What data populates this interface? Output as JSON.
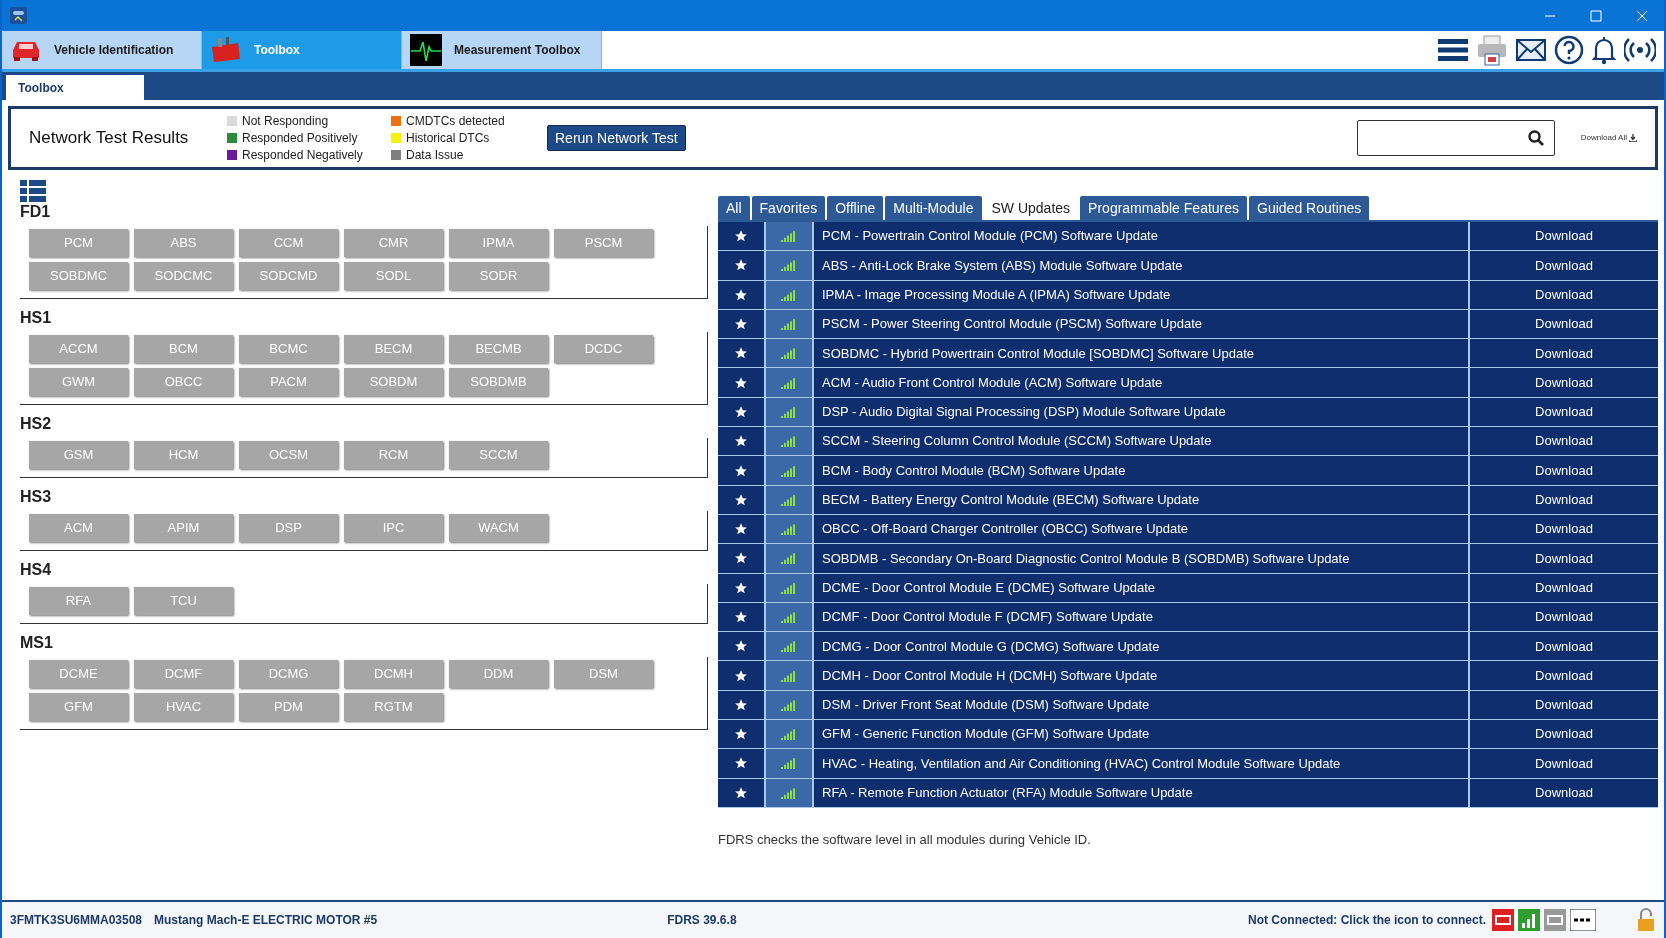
{
  "top_tabs": [
    {
      "label": "Vehicle Identification",
      "kind": "car",
      "selected": false
    },
    {
      "label": "Toolbox",
      "kind": "toolbox",
      "selected": true
    },
    {
      "label": "Measurement Toolbox",
      "kind": "scope",
      "selected": false
    }
  ],
  "sub_tabs": [
    {
      "label": "Toolbox",
      "selected": true
    }
  ],
  "network": {
    "title": "Network Test Results",
    "legend": [
      {
        "label": "Not Responding",
        "color": "#d9d9d9"
      },
      {
        "label": "Responded Positively",
        "color": "#2e8b3e"
      },
      {
        "label": "Responded Negatively",
        "color": "#6a1b9a"
      },
      {
        "label": "CMDTCs detected",
        "color": "#f07010"
      },
      {
        "label": "Historical DTCs",
        "color": "#f5f20a"
      },
      {
        "label": "Data Issue",
        "color": "#7f7f7f"
      }
    ],
    "rerun_button": "Rerun Network Test",
    "download_all": "Download All"
  },
  "groups": [
    {
      "name": "FD1",
      "modules": [
        "PCM",
        "ABS",
        "CCM",
        "CMR",
        "IPMA",
        "PSCM",
        "SOBDMC",
        "SODCMC",
        "SODCMD",
        "SODL",
        "SODR"
      ]
    },
    {
      "name": "HS1",
      "modules": [
        "ACCM",
        "BCM",
        "BCMC",
        "BECM",
        "BECMB",
        "DCDC",
        "GWM",
        "OBCC",
        "PACM",
        "SOBDM",
        "SOBDMB"
      ]
    },
    {
      "name": "HS2",
      "modules": [
        "GSM",
        "HCM",
        "OCSM",
        "RCM",
        "SCCM"
      ]
    },
    {
      "name": "HS3",
      "modules": [
        "ACM",
        "APIM",
        "DSP",
        "IPC",
        "WACM"
      ]
    },
    {
      "name": "HS4",
      "modules": [
        "RFA",
        "TCU"
      ]
    },
    {
      "name": "MS1",
      "modules": [
        "DCME",
        "DCMF",
        "DCMG",
        "DCMH",
        "DDM",
        "DSM",
        "GFM",
        "HVAC",
        "PDM",
        "RGTM"
      ]
    }
  ],
  "tool_tabs": [
    {
      "label": "All",
      "selected": false
    },
    {
      "label": "Favorites",
      "selected": false
    },
    {
      "label": "Offline",
      "selected": false
    },
    {
      "label": "Multi-Module",
      "selected": false
    },
    {
      "label": "SW Updates",
      "selected": true
    },
    {
      "label": "Programmable Features",
      "selected": false
    },
    {
      "label": "Guided Routines",
      "selected": false
    }
  ],
  "updates": [
    {
      "title": "PCM - Powertrain Control Module (PCM) Software Update",
      "action": "Download"
    },
    {
      "title": "ABS - Anti-Lock Brake System (ABS) Module Software Update",
      "action": "Download"
    },
    {
      "title": "IPMA - Image Processing Module A (IPMA) Software Update",
      "action": "Download"
    },
    {
      "title": "PSCM - Power Steering Control Module (PSCM) Software Update",
      "action": "Download"
    },
    {
      "title": "SOBDMC - Hybrid Powertrain Control Module [SOBDMC] Software Update",
      "action": "Download"
    },
    {
      "title": "ACM - Audio Front Control Module (ACM) Software Update",
      "action": "Download"
    },
    {
      "title": "DSP - Audio Digital Signal Processing (DSP) Module Software Update",
      "action": "Download"
    },
    {
      "title": "SCCM - Steering Column Control Module (SCCM) Software Update",
      "action": "Download"
    },
    {
      "title": "BCM - Body Control Module (BCM) Software Update",
      "action": "Download"
    },
    {
      "title": "BECM - Battery Energy Control Module (BECM) Software Update",
      "action": "Download"
    },
    {
      "title": "OBCC - Off-Board Charger Controller (OBCC) Software Update",
      "action": "Download"
    },
    {
      "title": "SOBDMB - Secondary On-Board Diagnostic Control Module B (SOBDMB) Software Update",
      "action": "Download"
    },
    {
      "title": "DCME - Door Control Module E (DCME) Software Update",
      "action": "Download"
    },
    {
      "title": "DCMF - Door Control Module F (DCMF) Software Update",
      "action": "Download"
    },
    {
      "title": "DCMG - Door Control Module G (DCMG) Software Update",
      "action": "Download"
    },
    {
      "title": "DCMH - Door Control Module H (DCMH) Software Update",
      "action": "Download"
    },
    {
      "title": "DSM - Driver Front Seat Module (DSM) Software Update",
      "action": "Download"
    },
    {
      "title": "GFM - Generic Function Module (GFM) Software Update",
      "action": "Download"
    },
    {
      "title": "HVAC - Heating, Ventilation and Air Conditioning (HVAC) Control Module Software Update",
      "action": "Download"
    },
    {
      "title": "RFA - Remote Function Actuator (RFA) Module Software Update",
      "action": "Download"
    }
  ],
  "footer_note": "FDRS checks the software level in all modules during Vehicle ID.",
  "status_bar": {
    "vin": "3FMTK3SU6MMA03508",
    "vehicle": "Mustang Mach-E ELECTRIC MOTOR #5",
    "version": "FDRS 39.6.8",
    "connection": "Not Connected: Click the icon to connect."
  }
}
